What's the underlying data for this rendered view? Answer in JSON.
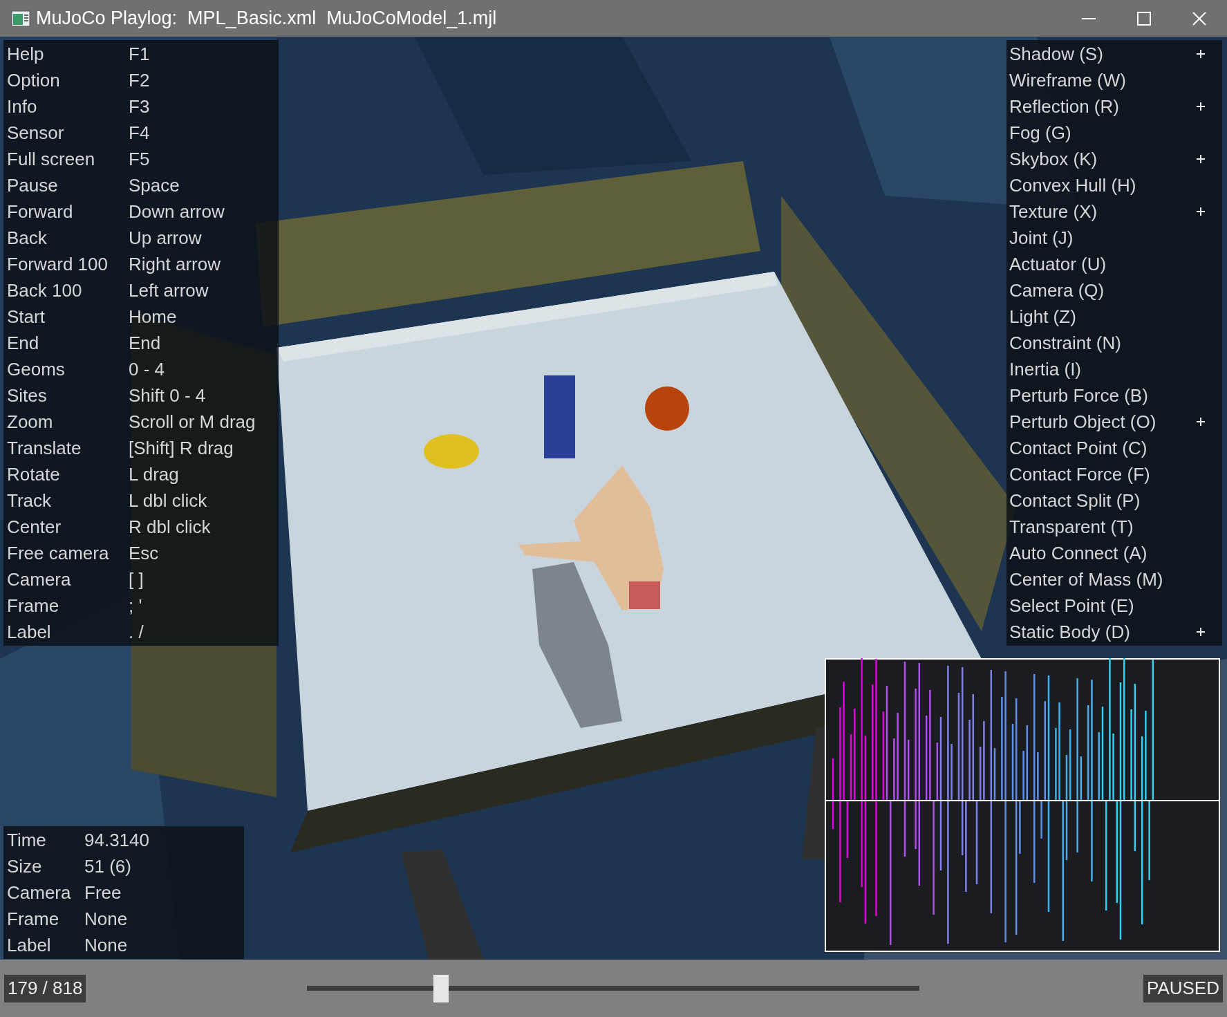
{
  "window": {
    "title": "MuJoCo Playlog:  MPL_Basic.xml  MuJoCoModel_1.mjl"
  },
  "help": [
    {
      "label": "Help",
      "key": "F1"
    },
    {
      "label": "Option",
      "key": "F2"
    },
    {
      "label": "Info",
      "key": "F3"
    },
    {
      "label": "Sensor",
      "key": "F4"
    },
    {
      "label": "Full screen",
      "key": "F5"
    },
    {
      "label": "Pause",
      "key": "Space"
    },
    {
      "label": "Forward",
      "key": "Down arrow"
    },
    {
      "label": "Back",
      "key": "Up arrow"
    },
    {
      "label": "Forward 100",
      "key": "Right arrow"
    },
    {
      "label": "Back 100",
      "key": "Left arrow"
    },
    {
      "label": "Start",
      "key": "Home"
    },
    {
      "label": "End",
      "key": "End"
    },
    {
      "label": "Geoms",
      "key": "0 - 4"
    },
    {
      "label": "Sites",
      "key": "Shift 0 - 4"
    },
    {
      "label": "Zoom",
      "key": "Scroll or M drag"
    },
    {
      "label": "Translate",
      "key": "[Shift] R drag"
    },
    {
      "label": "Rotate",
      "key": "L drag"
    },
    {
      "label": "Track",
      "key": "L dbl click"
    },
    {
      "label": "Center",
      "key": "R dbl click"
    },
    {
      "label": "Free camera",
      "key": "Esc"
    },
    {
      "label": "Camera",
      "key": "[ ]"
    },
    {
      "label": "Frame",
      "key": "; '"
    },
    {
      "label": "Label",
      "key": ". /"
    }
  ],
  "visual_flags": [
    {
      "label": "Shadow (S)",
      "checked": true
    },
    {
      "label": "Wireframe (W)",
      "checked": false
    },
    {
      "label": "Reflection (R)",
      "checked": true
    },
    {
      "label": "Fog (G)",
      "checked": false
    },
    {
      "label": "Skybox (K)",
      "checked": true
    },
    {
      "label": "Convex Hull (H)",
      "checked": false
    },
    {
      "label": "Texture (X)",
      "checked": true
    },
    {
      "label": "Joint (J)",
      "checked": false
    },
    {
      "label": "Actuator (U)",
      "checked": false
    },
    {
      "label": "Camera (Q)",
      "checked": false
    },
    {
      "label": "Light (Z)",
      "checked": false
    },
    {
      "label": "Constraint (N)",
      "checked": false
    },
    {
      "label": "Inertia (I)",
      "checked": false
    },
    {
      "label": "Perturb Force (B)",
      "checked": false
    },
    {
      "label": "Perturb Object (O)",
      "checked": true
    },
    {
      "label": "Contact Point (C)",
      "checked": false
    },
    {
      "label": "Contact Force (F)",
      "checked": false
    },
    {
      "label": "Contact Split (P)",
      "checked": false
    },
    {
      "label": "Transparent (T)",
      "checked": false
    },
    {
      "label": "Auto Connect (A)",
      "checked": false
    },
    {
      "label": "Center of Mass (M)",
      "checked": false
    },
    {
      "label": "Select Point (E)",
      "checked": false
    },
    {
      "label": "Static Body (D)",
      "checked": true
    }
  ],
  "info": [
    {
      "label": "Time",
      "value": "94.3140"
    },
    {
      "label": "Size",
      "value": "51 (6)"
    },
    {
      "label": "Camera",
      "value": "Free"
    },
    {
      "label": "Frame",
      "value": "None"
    },
    {
      "label": "Label",
      "value": "None"
    }
  ],
  "playback": {
    "counter": "179 / 818",
    "level": 0.219,
    "status": "PAUSED"
  }
}
